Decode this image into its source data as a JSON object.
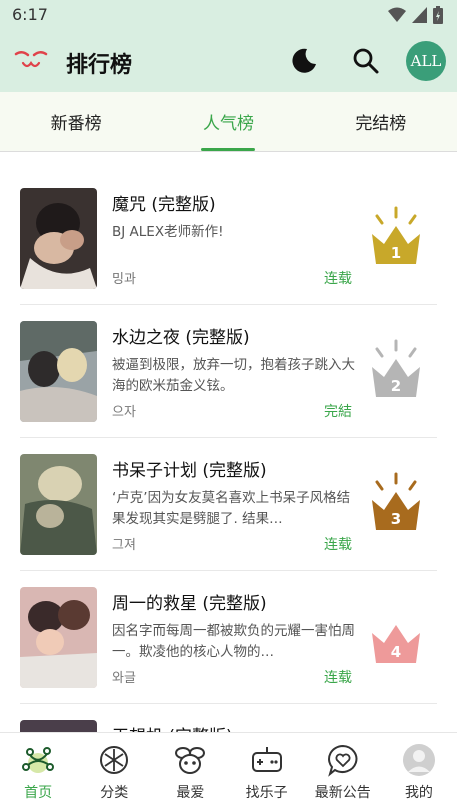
{
  "status": {
    "time": "6:17"
  },
  "app": {
    "title": "排行榜",
    "all_label": "ALL"
  },
  "tabs": [
    {
      "label": "新番榜",
      "active": false
    },
    {
      "label": "人气榜",
      "active": true
    },
    {
      "label": "完结榜",
      "active": false
    }
  ],
  "rank_list": [
    {
      "rank": "1",
      "title": "魔咒 (完整版)",
      "desc": "BJ ALEX老师新作!",
      "author": "밍과",
      "status": "连载",
      "crown_color": "#c8a82a"
    },
    {
      "rank": "2",
      "title": "水边之夜 (完整版)",
      "desc": "被逼到极限，放弃一切，抱着孩子跳入大海的欧米茄金义铉。",
      "author": "으자",
      "status": "完結",
      "crown_color": "#b5b5b5"
    },
    {
      "rank": "3",
      "title": "书呆子计划 (完整版)",
      "desc": "‘卢克’因为女友莫名喜欢上书呆子风格结果发现其实是劈腿了. 结果…",
      "author": "그져",
      "status": "连载",
      "crown_color": "#a86b1e"
    },
    {
      "rank": "4",
      "title": "周一的救星 (完整版)",
      "desc": "因名字而每周一都被欺负的元耀一害怕周一。欺凌他的核心人物的…",
      "author": "와글",
      "status": "连载",
      "crown_color": "#ee9a9a"
    },
    {
      "rank": "",
      "title": "王想机 (完整版)",
      "desc": "",
      "author": "",
      "status": "",
      "crown_color": "#ffffff"
    }
  ],
  "bottom_nav": [
    {
      "label": "首页",
      "icon": "home-flower-icon",
      "active": true
    },
    {
      "label": "分类",
      "icon": "category-icon",
      "active": false
    },
    {
      "label": "最爱",
      "icon": "favorite-bee-icon",
      "active": false
    },
    {
      "label": "找乐子",
      "icon": "gamepad-icon",
      "active": false
    },
    {
      "label": "最新公告",
      "icon": "announcement-heart-icon",
      "active": false
    },
    {
      "label": "我的",
      "icon": "profile-avatar-icon",
      "active": false
    }
  ],
  "colors": {
    "accent_green": "#3aa64a",
    "header_bg": "#d9eee1",
    "tab_bg": "#f7faf2",
    "avatar_bg": "#3a9e79"
  }
}
